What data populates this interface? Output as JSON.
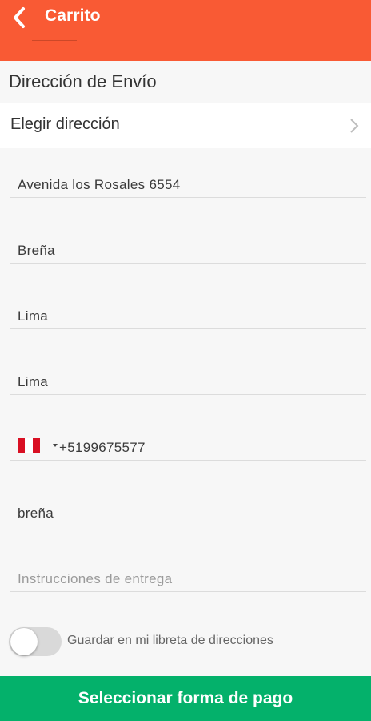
{
  "header": {
    "title": "Carrito",
    "back_icon": "chevron-left-icon",
    "color": "#f95a34"
  },
  "shipping": {
    "section_title": "Dirección de Envío",
    "choose_address_label": "Elegir dirección",
    "choose_icon": "chevron-right-icon"
  },
  "form": {
    "address": "Avenida los Rosales 6554",
    "district": "Breña",
    "province": "Lima",
    "department": "Lima",
    "phone": "+5199675577",
    "phone_country": "Peru",
    "reference": "breña",
    "instructions_placeholder": "Instrucciones de entrega",
    "instructions_value": ""
  },
  "save_toggle": {
    "label": "Guardar en mi libreta de direcciones",
    "on": false
  },
  "footer": {
    "button_label": "Seleccionar forma de pago",
    "color": "#04b16b"
  }
}
